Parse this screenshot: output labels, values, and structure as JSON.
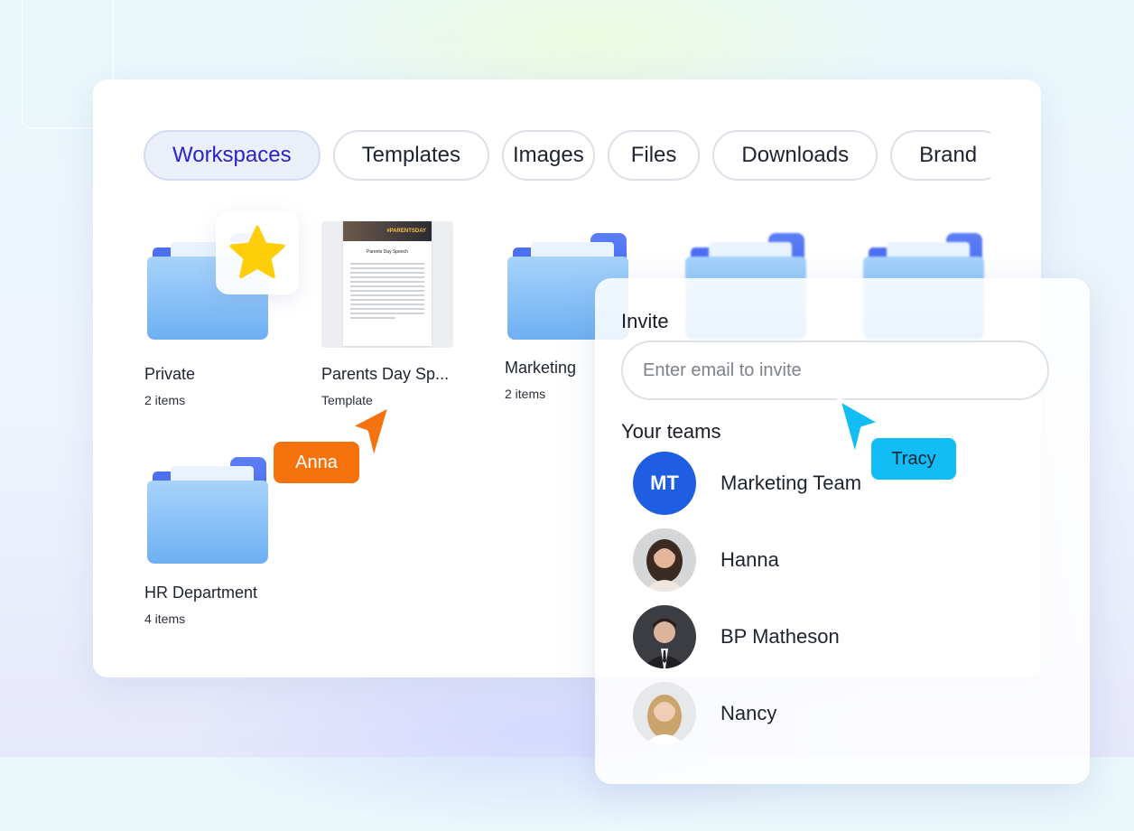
{
  "tabs": [
    {
      "label": "Workspaces",
      "active": true
    },
    {
      "label": "Templates",
      "active": false
    },
    {
      "label": "Images",
      "active": false
    },
    {
      "label": "Files",
      "active": false
    },
    {
      "label": "Downloads",
      "active": false
    },
    {
      "label": "Brand",
      "active": false
    }
  ],
  "items": [
    {
      "name": "Private",
      "sub": "2 items",
      "icon": "folder-icon",
      "badge": "star-icon"
    },
    {
      "name": "Parents Day Sp...",
      "sub": "Template",
      "icon": "document-thumbnail"
    },
    {
      "name": "Marketing",
      "sub": "2 items",
      "icon": "folder-icon"
    },
    {
      "name": "HR Department",
      "sub": "4 items",
      "icon": "folder-icon"
    }
  ],
  "doc_thumb": {
    "banner": "#PARENTSDAY",
    "title": "Parents Day Speech"
  },
  "cursors": {
    "anna": {
      "label": "Anna",
      "color": "#f6720c"
    },
    "tracy": {
      "label": "Tracy",
      "color": "#12bdf5"
    }
  },
  "invite": {
    "title": "Invite",
    "placeholder": "Enter email to invite",
    "teams_label": "Your teams"
  },
  "teams": [
    {
      "name": "Marketing Team",
      "initials": "MT",
      "avatar_color": "#1f5de3"
    },
    {
      "name": "Hanna",
      "avatar": "photo-avatar"
    },
    {
      "name": "BP Matheson",
      "avatar": "photo-avatar"
    },
    {
      "name": "Nancy",
      "avatar": "photo-avatar"
    }
  ]
}
